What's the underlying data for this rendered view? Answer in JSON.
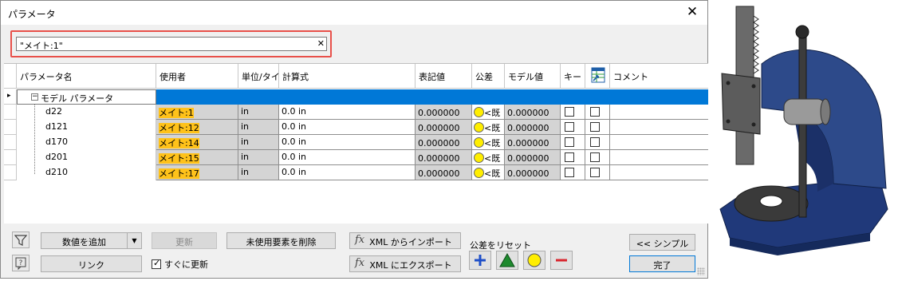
{
  "window": {
    "title": "パラメータ",
    "close_glyph": "✕"
  },
  "search": {
    "value": "\"メイト:1\"",
    "clear_glyph": "✕"
  },
  "columns": [
    "パラメータ名",
    "使用者",
    "単位/タイ",
    "計算式",
    "表記値",
    "公差",
    "モデル値",
    "キー",
    "",
    "コメント"
  ],
  "group_row": {
    "label": "モデル パラメータ",
    "toggle": "−"
  },
  "rows": [
    {
      "name": "d22",
      "used_by": "メイト:1",
      "unit": "in",
      "equation": "0.0 in",
      "nominal": "0.000000",
      "tolerance": "<既",
      "model": "0.000000"
    },
    {
      "name": "d121",
      "used_by": "メイト:12",
      "unit": "in",
      "equation": "0.0 in",
      "nominal": "0.000000",
      "tolerance": "<既",
      "model": "0.000000"
    },
    {
      "name": "d170",
      "used_by": "メイト:14",
      "unit": "in",
      "equation": "0.0 in",
      "nominal": "0.000000",
      "tolerance": "<既",
      "model": "0.000000"
    },
    {
      "name": "d201",
      "used_by": "メイト:15",
      "unit": "in",
      "equation": "0.0 in",
      "nominal": "0.000000",
      "tolerance": "<既",
      "model": "0.000000"
    },
    {
      "name": "d210",
      "used_by": "メイト:17",
      "unit": "in",
      "equation": "0.0 in",
      "nominal": "0.000000",
      "tolerance": "<既",
      "model": "0.000000"
    }
  ],
  "buttons": {
    "add_value": "数値を追加",
    "update": "更新",
    "remove_unused": "未使用要素を削除",
    "link": "リンク",
    "immediate_update": "すぐに更新",
    "xml_import": "XML からインポート",
    "xml_export": "XML にエクスポート",
    "simple": "<< シンプル",
    "done": "完了"
  },
  "tolerance_reset": {
    "label": "公差をリセット"
  },
  "colors": {
    "selection": "#0078d7",
    "highlight": "#ffc21a",
    "accent_red": "#e8504a",
    "model_blue": "#2d4a8a"
  },
  "icons": [
    "filter-icon",
    "help-icon",
    "fx-icon",
    "plus-icon",
    "triangle-icon",
    "circle-icon",
    "minus-icon",
    "table-icon"
  ]
}
